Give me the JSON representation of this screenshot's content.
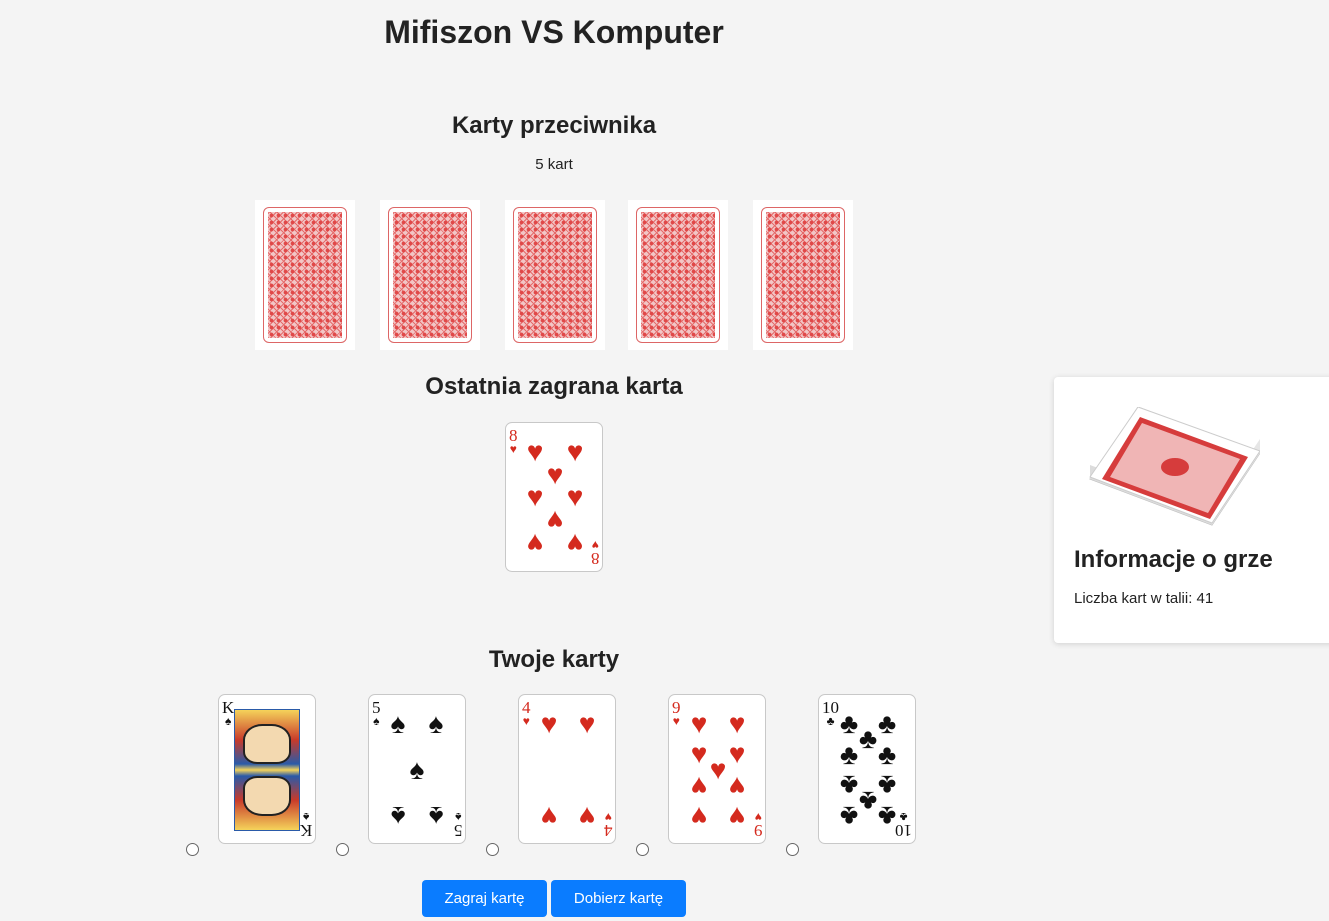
{
  "header": {
    "title": "Mifiszon VS Komputer"
  },
  "opponent": {
    "heading": "Karty przeciwnika",
    "count_label": "5 kart",
    "card_backs": 5
  },
  "last_played": {
    "heading": "Ostatnia zagrana karta",
    "card": {
      "rank": "8",
      "suit": "♥",
      "suit_name": "hearts",
      "color": "#d42a1e"
    }
  },
  "hand": {
    "heading": "Twoje karty",
    "cards": [
      {
        "rank": "K",
        "suit": "♠",
        "suit_name": "spades"
      },
      {
        "rank": "5",
        "suit": "♠",
        "suit_name": "spades"
      },
      {
        "rank": "4",
        "suit": "♥",
        "suit_name": "hearts"
      },
      {
        "rank": "9",
        "suit": "♥",
        "suit_name": "hearts"
      },
      {
        "rank": "10",
        "suit": "♣",
        "suit_name": "clubs"
      }
    ]
  },
  "actions": {
    "play_label": "Zagraj kartę",
    "draw_label": "Dobierz kartę"
  },
  "info": {
    "heading": "Informacje o grze",
    "deck_count_label": "Liczba kart w talii: 41"
  },
  "colors": {
    "button": "#0a7cff",
    "red_suit": "#d42a1e",
    "black_suit": "#111111",
    "background": "#f4f4f4"
  }
}
